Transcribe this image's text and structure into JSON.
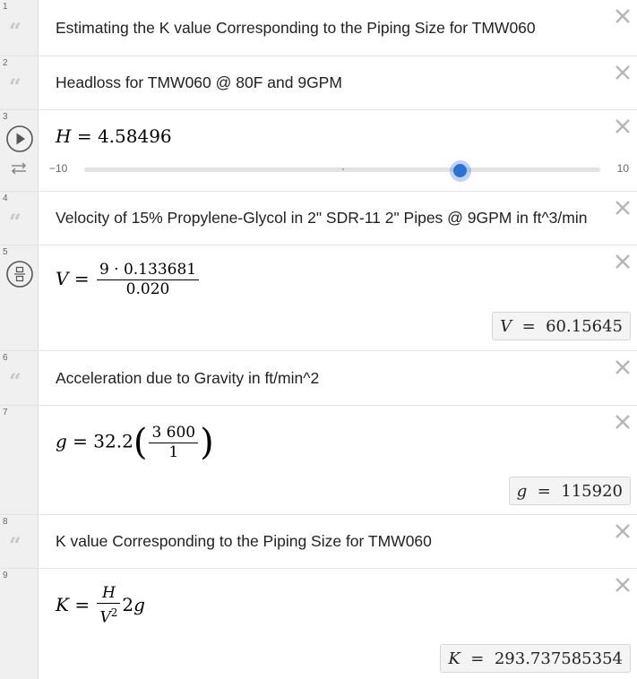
{
  "rows": [
    {
      "n": "1",
      "text": "Estimating the K value Corresponding to the Piping Size for TMW060"
    },
    {
      "n": "2",
      "text": "Headloss for TMW060 @ 80F and 9GPM"
    },
    {
      "n": "3",
      "lhs": "H",
      "eq": "=",
      "rhs": "4.58496",
      "slider": {
        "min": "−10",
        "max": "10",
        "value": 4.58496,
        "min_value": -10,
        "max_value": 10
      }
    },
    {
      "n": "4",
      "text": "Velocity of 15% Propylene-Glycol in 2\" SDR-11 2\" Pipes @ 9GPM in ft^3/min"
    },
    {
      "n": "5",
      "lhs": "V",
      "eq": "=",
      "num": "9 · 0.133681",
      "den": "0.020",
      "result": {
        "var": "V",
        "eq": "=",
        "value": "60.15645"
      }
    },
    {
      "n": "6",
      "text": "Acceleration due to Gravity in ft/min^2"
    },
    {
      "n": "7",
      "lhs": "g",
      "eq": "=",
      "coef": "32.2",
      "num": "3 600",
      "den": "1",
      "result": {
        "var": "g",
        "eq": "=",
        "value": "115920"
      }
    },
    {
      "n": "8",
      "text": "K value Corresponding to the Piping Size for TMW060"
    },
    {
      "n": "9",
      "lhs": "K",
      "eq": "=",
      "num": "H",
      "den_base": "V",
      "den_exp": "2",
      "tail_coef": "2",
      "tail_var": "g",
      "result": {
        "var": "K",
        "eq": "=",
        "value": "293.737585354"
      }
    }
  ],
  "icons": {
    "note": "quote-icon",
    "delete": "close-icon",
    "play": "play-icon",
    "loop": "repeat-icon",
    "fraction": "fraction-toggle-icon"
  },
  "colors": {
    "accent": "#2c72d4",
    "gutter": "#f0f0f0",
    "delete": "#b5b5b5"
  }
}
